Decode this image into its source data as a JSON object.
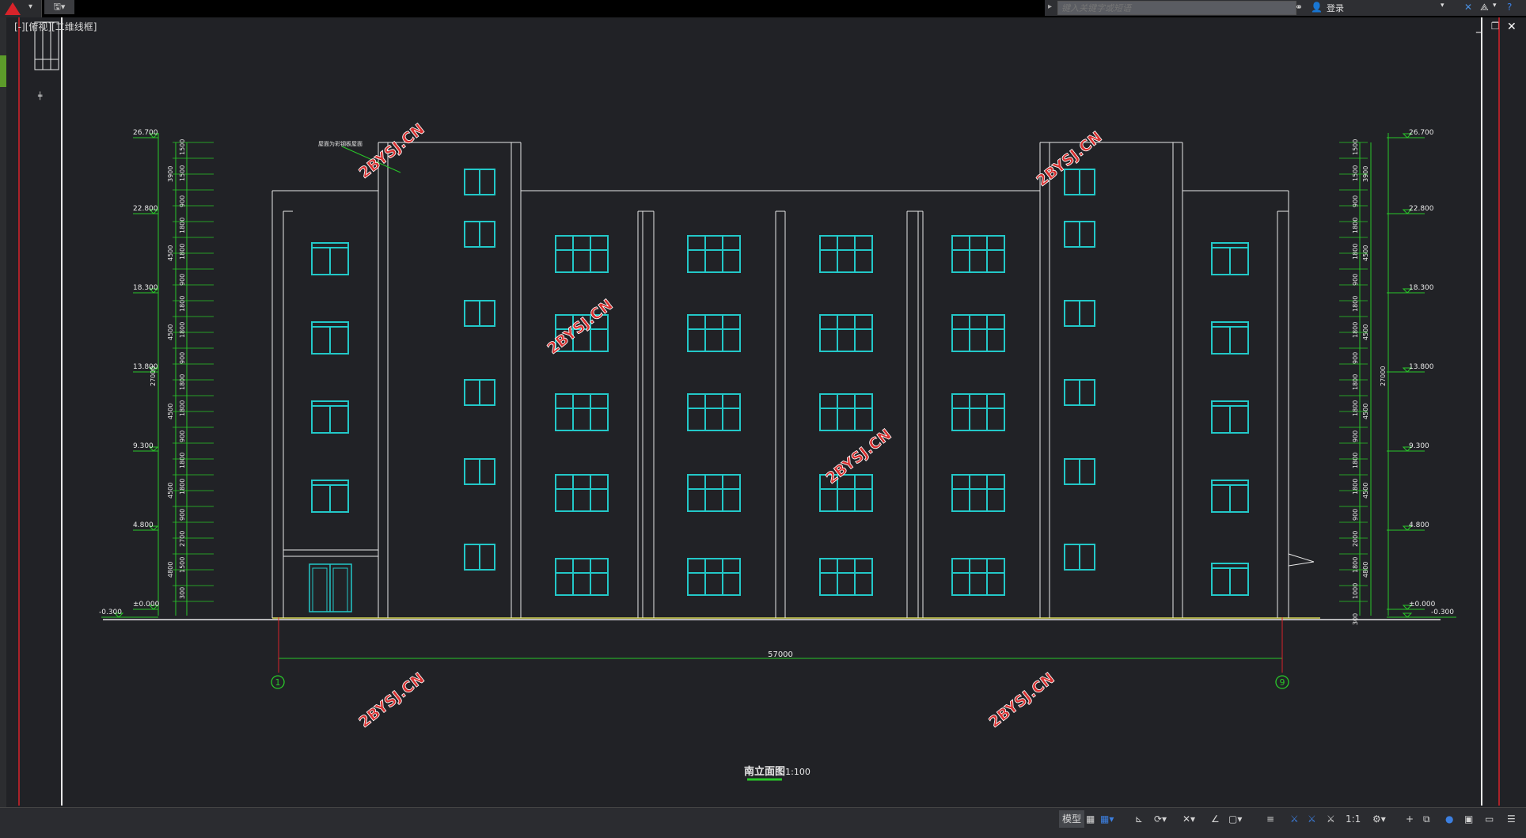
{
  "toolbar": {
    "search_placeholder": "键入关键字或短语",
    "login_label": "登录"
  },
  "viewport": {
    "label": "[-][俯视][二维线框]"
  },
  "drawing": {
    "title": "南立面图",
    "scale": "1:100",
    "total_dimension": "57000",
    "axis_left": "1",
    "axis_right": "9",
    "annotation": "屋面为彩钢板屋面",
    "watermark": "2BYSJ.CN",
    "elevations_left": [
      "26.700",
      "22.800",
      "18.300",
      "13.800",
      "9.300",
      "4.800",
      "±0.000",
      "-0.300"
    ],
    "elevations_right": [
      "26.700",
      "22.800",
      "18.300",
      "13.800",
      "9.300",
      "4.800",
      "±0.000",
      "-0.300"
    ],
    "dims_left_inner": [
      "1500",
      "1500",
      "900",
      "1800",
      "1800",
      "900",
      "1800",
      "1800",
      "900",
      "1800",
      "1800",
      "900",
      "1800",
      "1800",
      "900",
      "2700",
      "1500",
      "300"
    ],
    "dims_left_outer": [
      "3900",
      "4500",
      "4500",
      "4500",
      "4500",
      "4800"
    ],
    "dims_left_total": "27000",
    "dims_right_inner": [
      "1500",
      "1500",
      "900",
      "1800",
      "1800",
      "900",
      "1800",
      "1800",
      "900",
      "1800",
      "1800",
      "900",
      "1800",
      "1800",
      "900",
      "2000",
      "1800",
      "1000",
      "300"
    ],
    "dims_right_outer": [
      "3900",
      "4500",
      "4500",
      "4500",
      "4500",
      "4800"
    ],
    "dims_right_total": "27000",
    "colors": {
      "wall_lines": "#e8e8e8",
      "windows": "#23c8c8",
      "dimensions": "#29c729",
      "ground": "#d8d856",
      "watermark": "#d83030",
      "background": "#212226"
    }
  },
  "statusbar": {
    "model_label": "模型",
    "annotation_scale": "1:1"
  }
}
